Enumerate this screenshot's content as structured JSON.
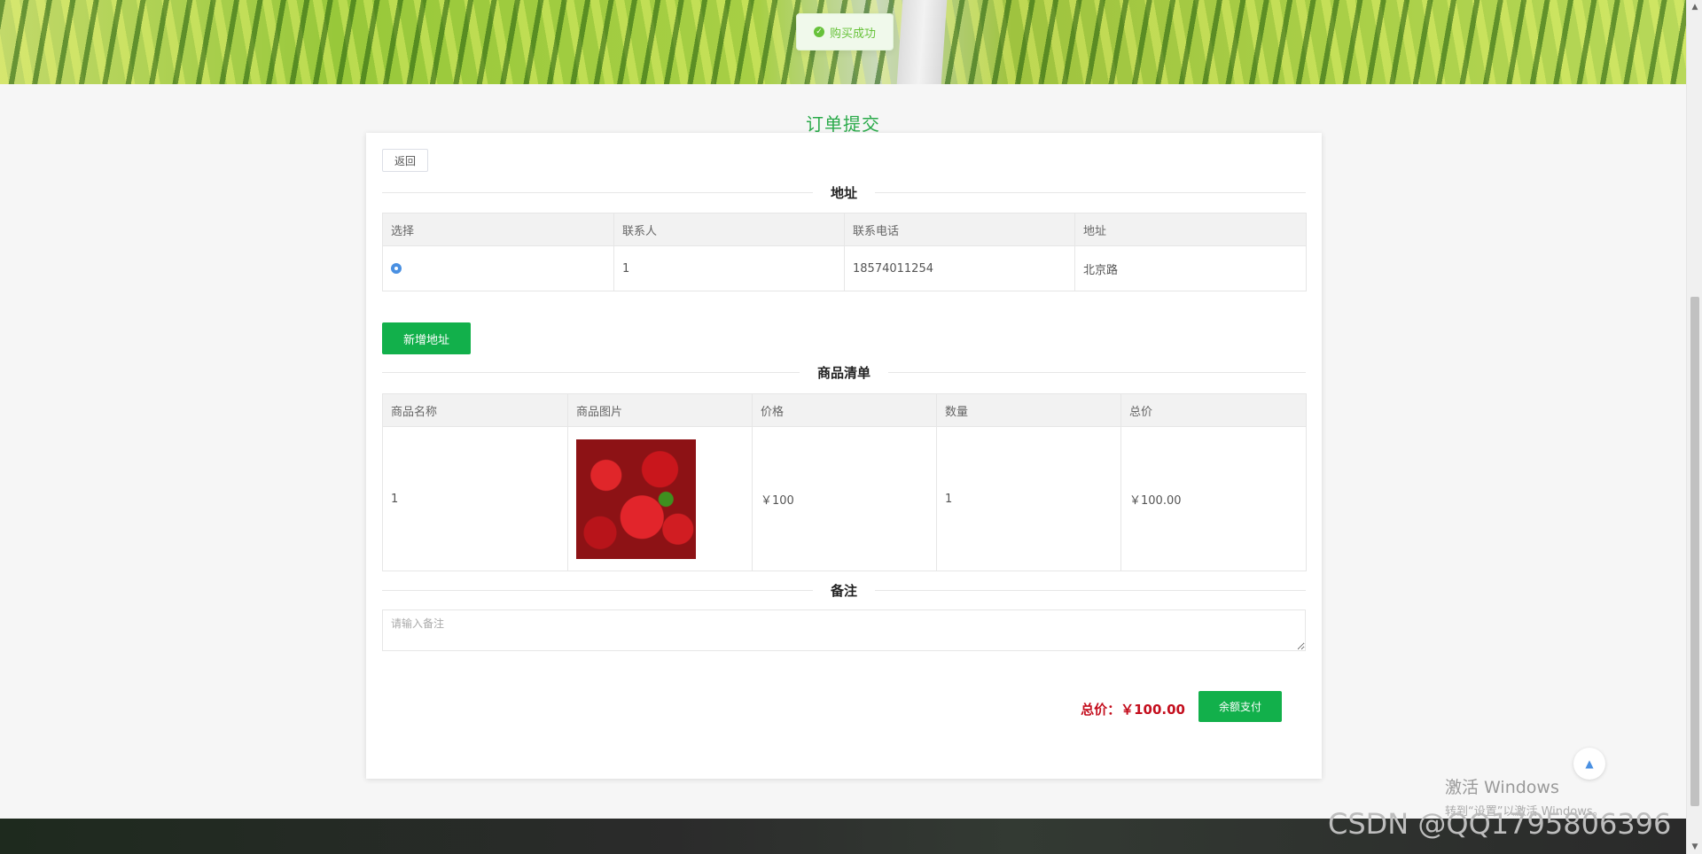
{
  "toast": {
    "text": "购买成功",
    "icon": "success-check-icon"
  },
  "page_title": "订单提交",
  "back_button": "返回",
  "address_section": {
    "title": "地址",
    "columns": [
      "选择",
      "联系人",
      "联系电话",
      "地址"
    ],
    "rows": [
      {
        "contact": "1",
        "phone": "18574011254",
        "address": "北京路",
        "selected": true
      }
    ],
    "add_button": "新增地址"
  },
  "goods_section": {
    "title": "商品清单",
    "columns": [
      "商品名称",
      "商品图片",
      "价格",
      "数量",
      "总价"
    ],
    "rows": [
      {
        "name": "1",
        "image": "strawberry-photo",
        "price": "￥100",
        "quantity": "1",
        "total": "￥100.00"
      }
    ]
  },
  "remark_section": {
    "title": "备注",
    "placeholder": "请输入备注"
  },
  "summary": {
    "total_text": "总价：￥100.00",
    "pay_button": "余额支付"
  },
  "overlay": {
    "activation_title": "激活 Windows",
    "activation_hint": "转到“设置”以激活 Windows。",
    "csdn_watermark": "CSDN @QQ1795806396"
  },
  "colors": {
    "accent_green": "#12b04b",
    "title_green": "#2aaa4a",
    "price_red": "#c40f1e",
    "radio_blue": "#4a90e2"
  }
}
